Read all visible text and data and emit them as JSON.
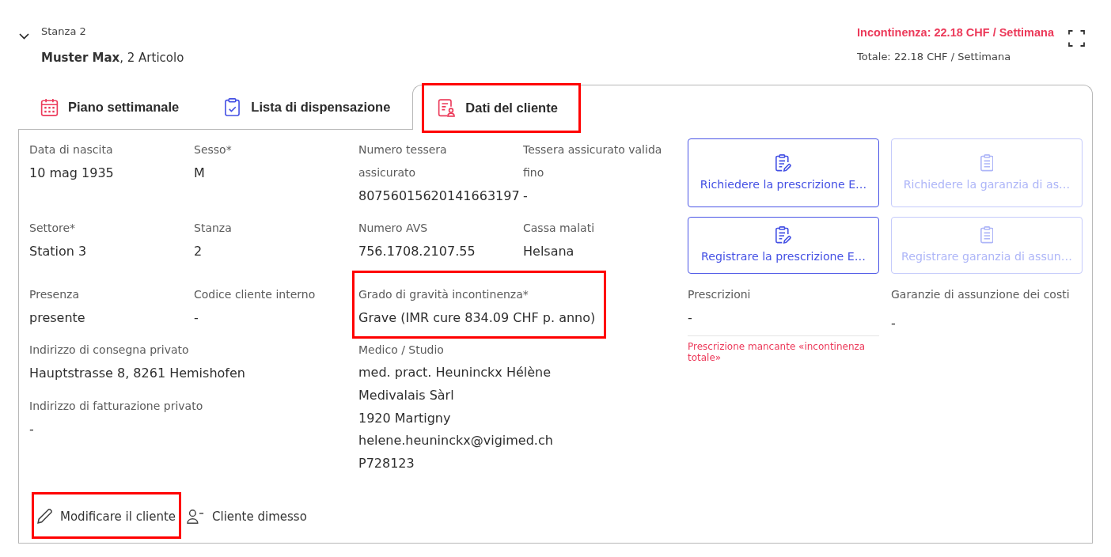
{
  "header": {
    "room": "Stanza 2",
    "expanded": true,
    "client": "**Muster Max**, 2 Articolo",
    "incontinence_cost": "Incontinenza: 22.18 CHF / Settimana",
    "total_cost": "Totale: 22.18 CHF / Settimana"
  },
  "tabs": [
    {
      "kind": "plan",
      "label": "Piano settimanale",
      "selected": false,
      "highlighted": false
    },
    {
      "kind": "list",
      "label": "Lista di dispensazione",
      "selected": false,
      "highlighted": false
    },
    {
      "kind": "client",
      "label": "Dati del cliente",
      "selected": true,
      "highlighted": true
    }
  ],
  "details": {
    "rows": [
      [
        {
          "label": "Data di nascita",
          "value": "10 mag 1935",
          "highlighted": false
        },
        {
          "label": "Sesso*",
          "value": "M",
          "highlighted": false
        },
        {
          "label": "Numero tessera assicurato",
          "value": "80756015620141663197",
          "highlighted": false
        },
        {
          "label": "Tessera assicurato valida fino",
          "value": "-",
          "highlighted": false
        }
      ],
      [
        {
          "label": "Settore*",
          "value": "Station 3",
          "highlighted": false
        },
        {
          "label": "Stanza",
          "value": "2",
          "highlighted": false
        },
        {
          "label": "Numero AVS",
          "value": "756.1708.2107.55",
          "highlighted": false
        },
        {
          "label": "Cassa malati",
          "value": "Helsana",
          "highlighted": false
        }
      ],
      [
        {
          "label": "Presenza",
          "value": "presente",
          "highlighted": false
        },
        {
          "label": "Codice cliente interno",
          "value": "-",
          "highlighted": false
        },
        {
          "label": "Grado di gravità incontinenza*",
          "value": "Grave (IMR cure 834.09 CHF p. anno)",
          "highlighted": true
        }
      ]
    ],
    "addresses": [
      {
        "label": "Indirizzo di consegna privato",
        "value": "Hauptstrasse 8, 8261 Hemishofen"
      },
      {
        "label": "Indirizzo di fatturazione privato",
        "value": "-"
      }
    ],
    "doctor": {
      "label": "Medico / Studio",
      "lines": [
        "med. pract. Heuninckx Hélène",
        "Medivalais Sàrl",
        "1920 Martigny",
        "helene.heuninckx@vigimed.ch",
        "P728123"
      ]
    }
  },
  "actions": [
    {
      "kind": "prescription",
      "label": "Richiedere la prescrizione E…",
      "disabled": false
    },
    {
      "kind": "guarantee",
      "label": "Richiedere la garanzia di as…",
      "disabled": true
    },
    {
      "kind": "prescription",
      "label": "Registrare la prescrizione E…",
      "disabled": false
    },
    {
      "kind": "guarantee",
      "label": "Registrare garanzia di assun…",
      "disabled": true
    }
  ],
  "prescriptions": {
    "label": "Prescrizioni",
    "value": "-",
    "warning": "Prescrizione mancante «incontinenza totale»"
  },
  "cost_guarantees": {
    "label": "Garanzie di assunzione dei costi",
    "value": "-"
  },
  "footer_actions": [
    {
      "kind": "edit",
      "label": "Modificare il cliente",
      "highlighted": true
    },
    {
      "kind": "discharge",
      "label": "Cliente dimesso",
      "highlighted": false
    }
  ]
}
